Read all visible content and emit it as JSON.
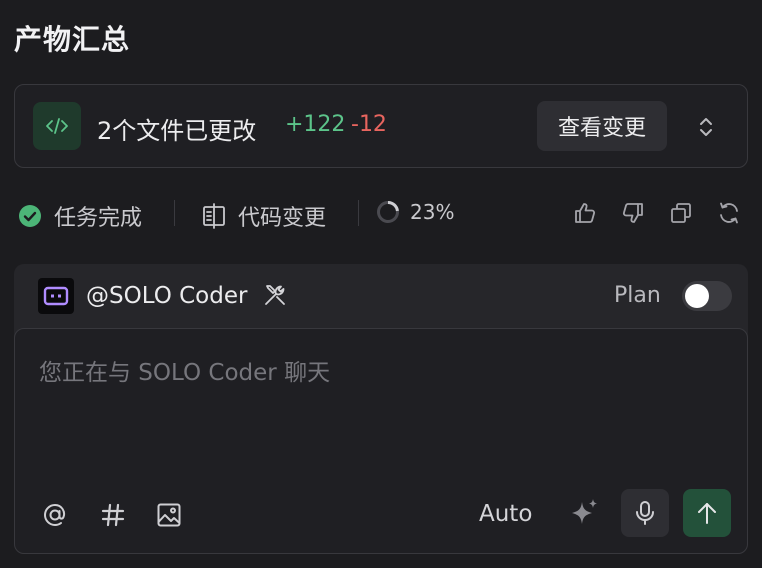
{
  "header": {
    "title": "产物汇总"
  },
  "summary": {
    "files_changed": "2个文件已更改",
    "added": "+122",
    "removed": "-12",
    "view_changes_label": "查看变更",
    "colors": {
      "added": "#5cc48a",
      "removed": "#e8655f",
      "badge": "#1f3a2c"
    }
  },
  "status": {
    "task_done": "任务完成",
    "code_changes": "代码变更",
    "progress": "23%",
    "progress_value": 0.23,
    "check_color": "#4cb577"
  },
  "chat": {
    "agent": "@SOLO Coder",
    "plan_label": "Plan",
    "plan_enabled": false,
    "placeholder": "您正在与 SOLO Coder 聊天",
    "model_label": "Auto",
    "send_color": "#23513a"
  },
  "icons": {
    "code": "code-icon",
    "expand": "chevron-up-down-icon",
    "check": "check-circle-icon",
    "diff": "diff-icon",
    "progress": "progress-ring-icon",
    "like": "thumbs-up-icon",
    "dislike": "thumbs-down-icon",
    "copy": "copy-icon",
    "refresh": "refresh-icon",
    "bot": "bot-icon",
    "tools": "tools-icon",
    "mention": "at-icon",
    "hash": "hash-icon",
    "image": "image-icon",
    "sparkle": "sparkle-icon",
    "mic": "mic-icon",
    "send": "arrow-up-icon"
  }
}
